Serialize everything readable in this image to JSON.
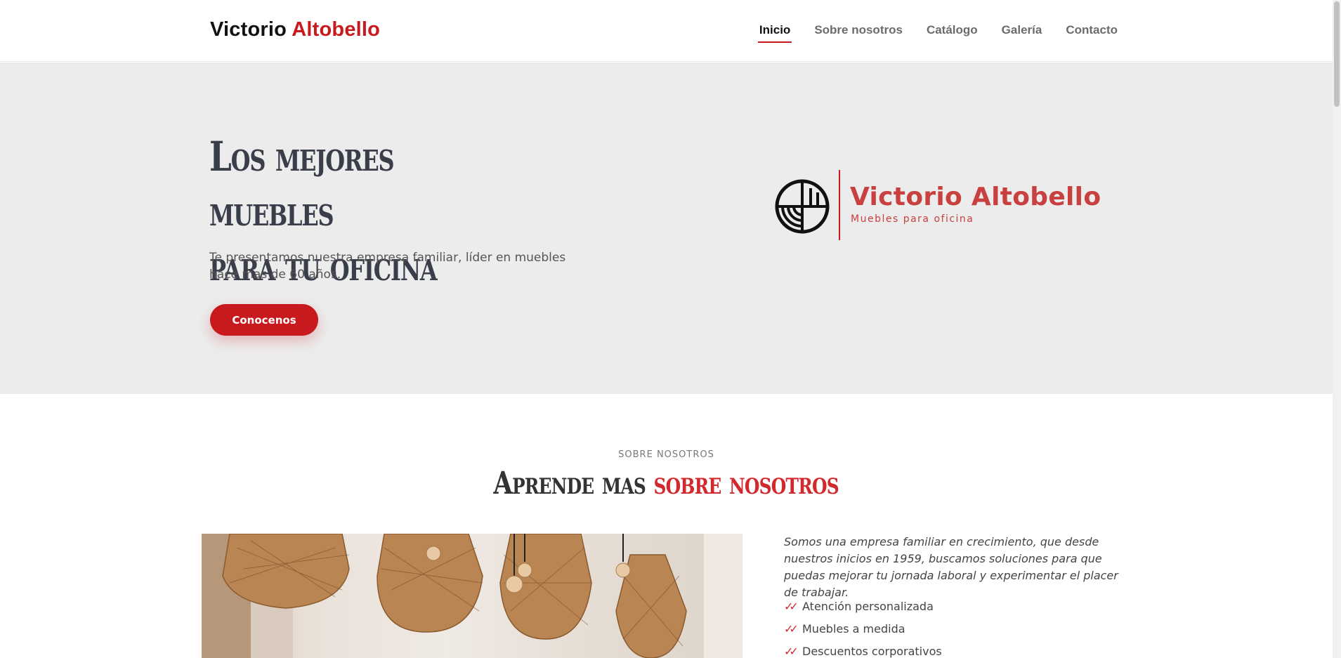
{
  "header": {
    "logo_first": "Victorio",
    "logo_second": "Altobello",
    "nav": [
      {
        "label": "Inicio"
      },
      {
        "label": "Sobre nosotros"
      },
      {
        "label": "Catálogo"
      },
      {
        "label": "Galería"
      },
      {
        "label": "Contacto"
      }
    ],
    "active_nav": "Inicio"
  },
  "hero": {
    "title_line1": "Los mejores muebles",
    "title_line2": "para tu oficina",
    "text": "Te presentamos nuestra empresa familiar, líder en muebles hace mas de 60 años.",
    "button_label": "Conocenos",
    "brand_name": "Victorio Altobello",
    "brand_tagline": "Muebles para oficina"
  },
  "about": {
    "eyebrow": "SOBRE NOSOTROS",
    "title_part1": "Aprende mas",
    "title_part2": "sobre nosotros",
    "paragraph": "Somos una empresa familiar en crecimiento, que desde nuestros inicios en 1959, buscamos soluciones para que puedas mejorar tu jornada laboral y experimentar el placer de trabajar.",
    "list": [
      {
        "label": "Atención personalizada"
      },
      {
        "label": "Muebles a medida"
      },
      {
        "label": "Descuentos corporativos"
      }
    ]
  },
  "colors": {
    "accent": "#c81a1e",
    "hero_bg": "#ececec",
    "title_text": "#3a3d4a"
  }
}
